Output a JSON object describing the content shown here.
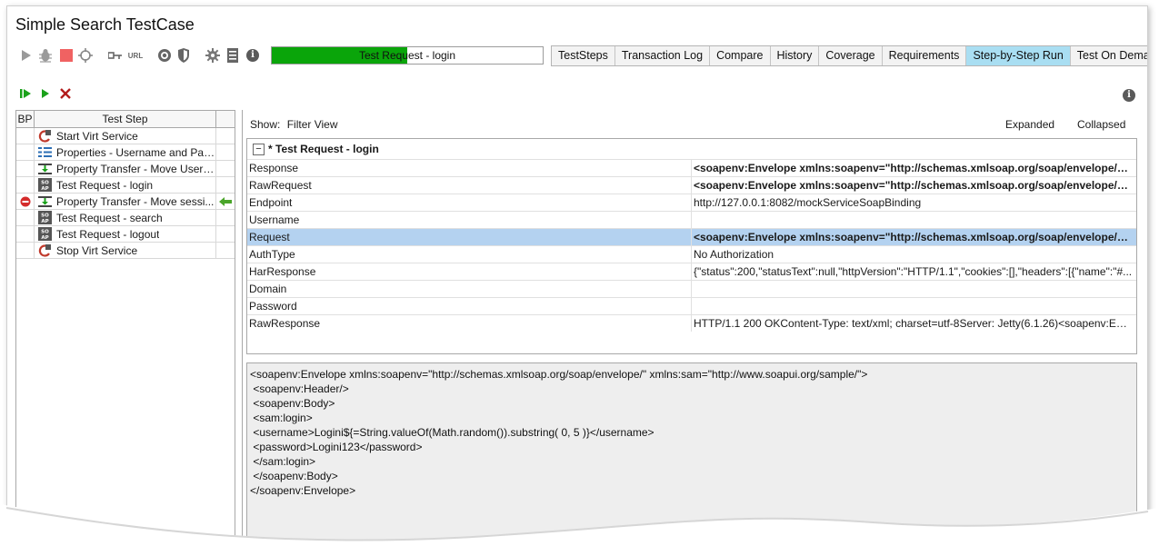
{
  "window": {
    "title": "Simple Search TestCase"
  },
  "toolbar": {
    "icons": [
      "play-icon",
      "debug-bug-icon",
      "stop-icon",
      "loop-icon",
      "property-key-icon",
      "url-icon",
      "coverage-icon",
      "security-shield-icon",
      "gear-icon",
      "list-icon",
      "info-icon"
    ],
    "url_label": "URL",
    "progress": {
      "label": "Test Request - login",
      "fraction": 0.5,
      "color": "#0aa50a"
    }
  },
  "tabs": [
    {
      "label": "TestSteps",
      "active": false
    },
    {
      "label": "Transaction Log",
      "active": false
    },
    {
      "label": "Compare",
      "active": false
    },
    {
      "label": "History",
      "active": false
    },
    {
      "label": "Coverage",
      "active": false
    },
    {
      "label": "Requirements",
      "active": false
    },
    {
      "label": "Step-by-Step Run",
      "active": true
    },
    {
      "label": "Test On Demand",
      "active": false
    }
  ],
  "debug_toolbar": {
    "icons": [
      "step-forward-icon",
      "run-icon",
      "delete-icon"
    ]
  },
  "steps_table": {
    "headers": {
      "bp": "BP",
      "step": "Test Step"
    },
    "rows": [
      {
        "label": "Start Virt Service",
        "icon": "virt-start-icon",
        "breakpoint": false,
        "current": false
      },
      {
        "label": "Properties - Username and Pas...",
        "icon": "properties-icon",
        "breakpoint": false,
        "current": false
      },
      {
        "label": "Property Transfer - Move Usern...",
        "icon": "transfer-icon",
        "breakpoint": false,
        "current": false
      },
      {
        "label": "Test Request - login",
        "icon": "soap-request-icon",
        "breakpoint": false,
        "current": false
      },
      {
        "label": "Property Transfer - Move sessi...",
        "icon": "transfer-icon",
        "breakpoint": true,
        "current": true
      },
      {
        "label": "Test Request - search",
        "icon": "soap-request-icon",
        "breakpoint": false,
        "current": false
      },
      {
        "label": "Test Request - logout",
        "icon": "soap-request-icon",
        "breakpoint": false,
        "current": false
      },
      {
        "label": "Stop Virt Service",
        "icon": "virt-stop-icon",
        "breakpoint": false,
        "current": false
      }
    ]
  },
  "inspector": {
    "show_label": "Show:",
    "filter_label": "Filter View",
    "expanded_label": "Expanded",
    "collapsed_label": "Collapsed",
    "group_title": "* Test Request - login",
    "rows": [
      {
        "name": "Response",
        "value": "<soapenv:Envelope xmlns:soapenv=\"http://schemas.xmlsoap.org/soap/envelope/\" x...",
        "bold": true,
        "selected": false
      },
      {
        "name": "RawRequest",
        "value": "<soapenv:Envelope xmlns:soapenv=\"http://schemas.xmlsoap.org/soap/envelope/\" x...",
        "bold": true,
        "selected": false
      },
      {
        "name": "Endpoint",
        "value": "http://127.0.0.1:8082/mockServiceSoapBinding",
        "bold": false,
        "selected": false
      },
      {
        "name": "Username",
        "value": "",
        "bold": false,
        "selected": false
      },
      {
        "name": "Request",
        "value": "<soapenv:Envelope xmlns:soapenv=\"http://schemas.xmlsoap.org/soap/envelope/\" x...",
        "bold": true,
        "selected": true
      },
      {
        "name": "AuthType",
        "value": "No Authorization",
        "bold": false,
        "selected": false
      },
      {
        "name": "HarResponse",
        "value": "{\"status\":200,\"statusText\":null,\"httpVersion\":\"HTTP/1.1\",\"cookies\":[],\"headers\":[{\"name\":\"#...",
        "bold": false,
        "selected": false
      },
      {
        "name": "Domain",
        "value": "",
        "bold": false,
        "selected": false
      },
      {
        "name": "Password",
        "value": "",
        "bold": false,
        "selected": false
      },
      {
        "name": "RawResponse",
        "value": "HTTP/1.1 200 OKContent-Type: text/xml; charset=utf-8Server: Jetty(6.1.26)<soapenv:Envel...",
        "bold": false,
        "selected": false
      }
    ]
  },
  "editor": {
    "lines": [
      "<soapenv:Envelope xmlns:soapenv=\"http://schemas.xmlsoap.org/soap/envelope/\" xmlns:sam=\"http://www.soapui.org/sample/\">",
      " <soapenv:Header/>",
      " <soapenv:Body>",
      " <sam:login>",
      " <username>Logini${=String.valueOf(Math.random()).substring( 0, 5 )}</username>",
      " <password>Logini123</password>",
      " </sam:login>",
      " </soapenv:Body>",
      "</soapenv:Envelope>"
    ]
  }
}
